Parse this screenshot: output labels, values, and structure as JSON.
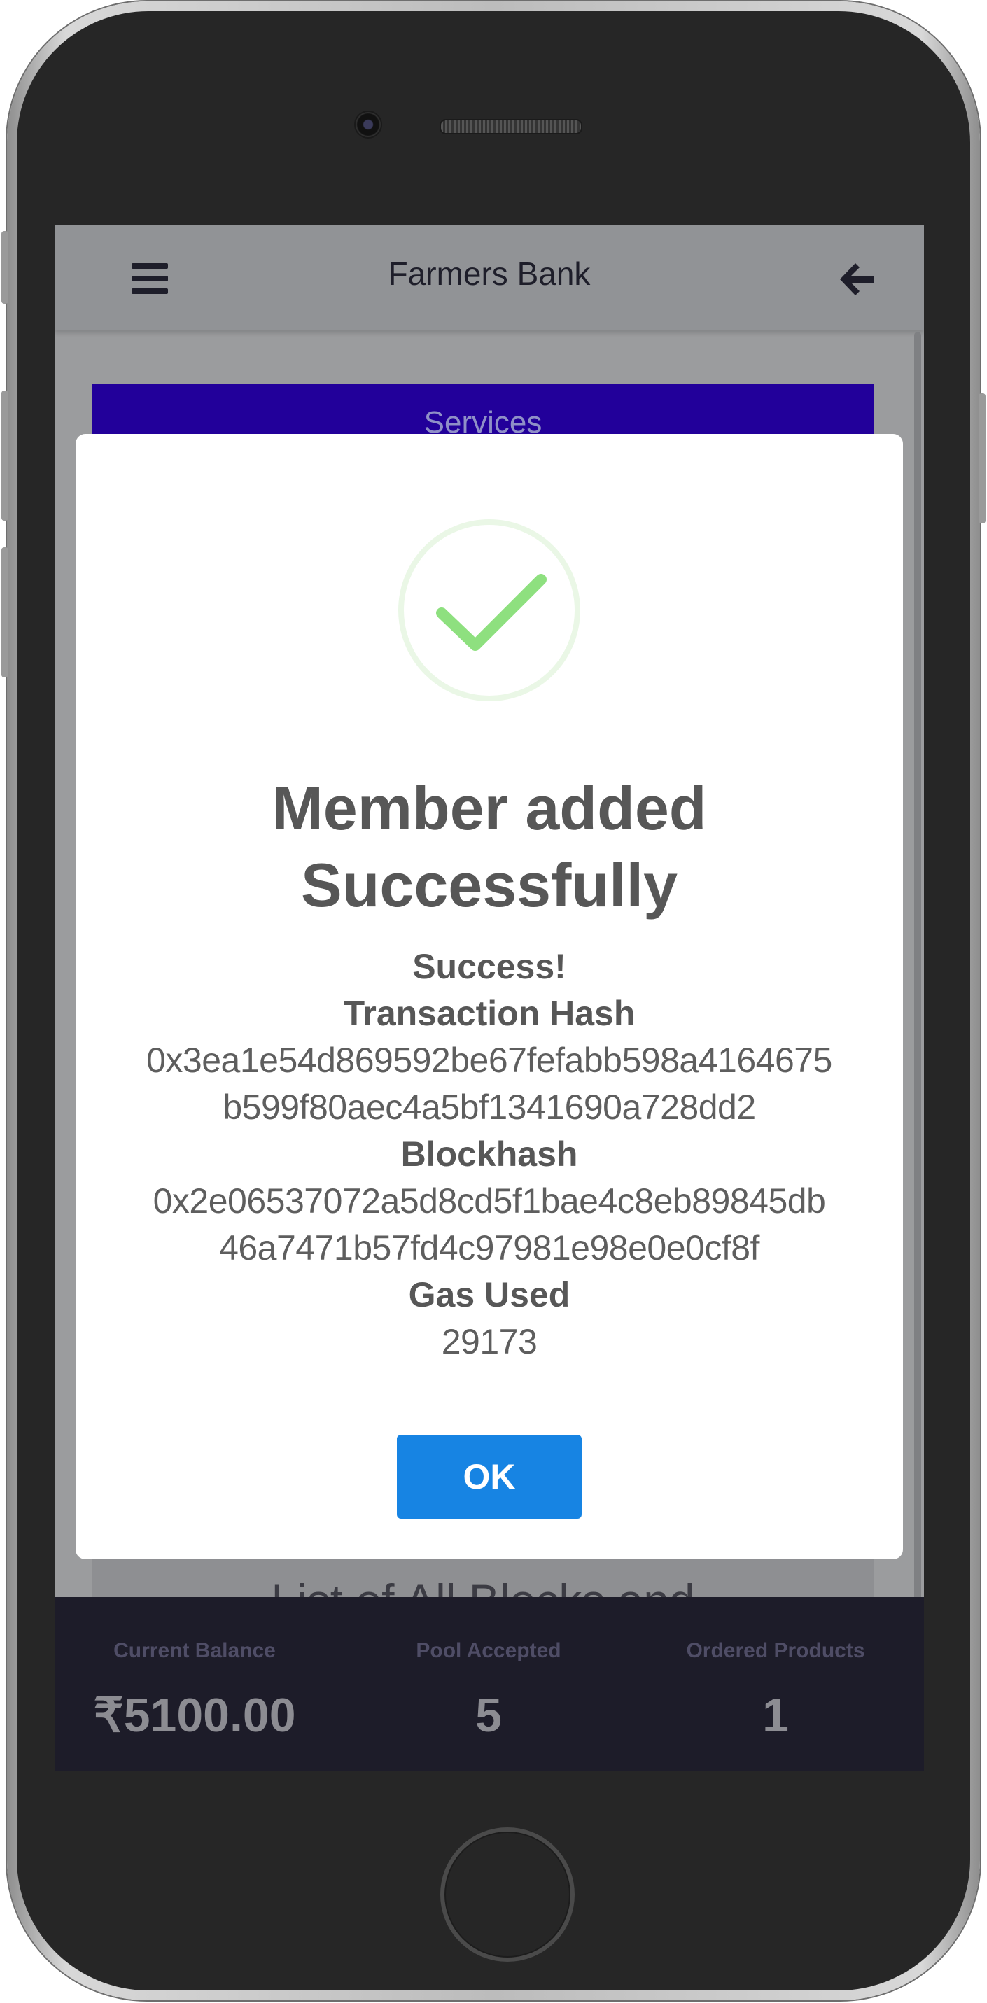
{
  "header": {
    "title": "Farmers Bank"
  },
  "services": {
    "label": "Services"
  },
  "list": {
    "heading": "List of All Blocks and"
  },
  "stats": [
    {
      "label": "Current Balance",
      "value": "₹5100.00"
    },
    {
      "label": "Pool Accepted",
      "value": "5"
    },
    {
      "label": "Ordered Products",
      "value": "1"
    }
  ],
  "modal": {
    "title_line1": "Member added",
    "title_line2": "Successfully",
    "success_label": "Success!",
    "tx_hash_label": "Transaction Hash",
    "tx_hash_line1": "0x3ea1e54d869592be67fefabb598a4164675",
    "tx_hash_line2": "b599f80aec4a5bf1341690a728dd2",
    "blockhash_label": "Blockhash",
    "blockhash_line1": "0x2e06537072a5d8cd5f1bae4c8eb89845db",
    "blockhash_line2": "46a7471b57fd4c97981e98e0e0cf8f",
    "gas_label": "Gas Used",
    "gas_value": "29173",
    "ok_label": "OK"
  },
  "icons": {
    "menu": "menu-icon",
    "back": "back-arrow-icon",
    "success": "checkmark-circle-icon"
  },
  "colors": {
    "services_bar": "#22009a",
    "ok_button": "#1784e3",
    "success_check": "#8ee07f",
    "bottom_bar": "#1d1c29"
  }
}
